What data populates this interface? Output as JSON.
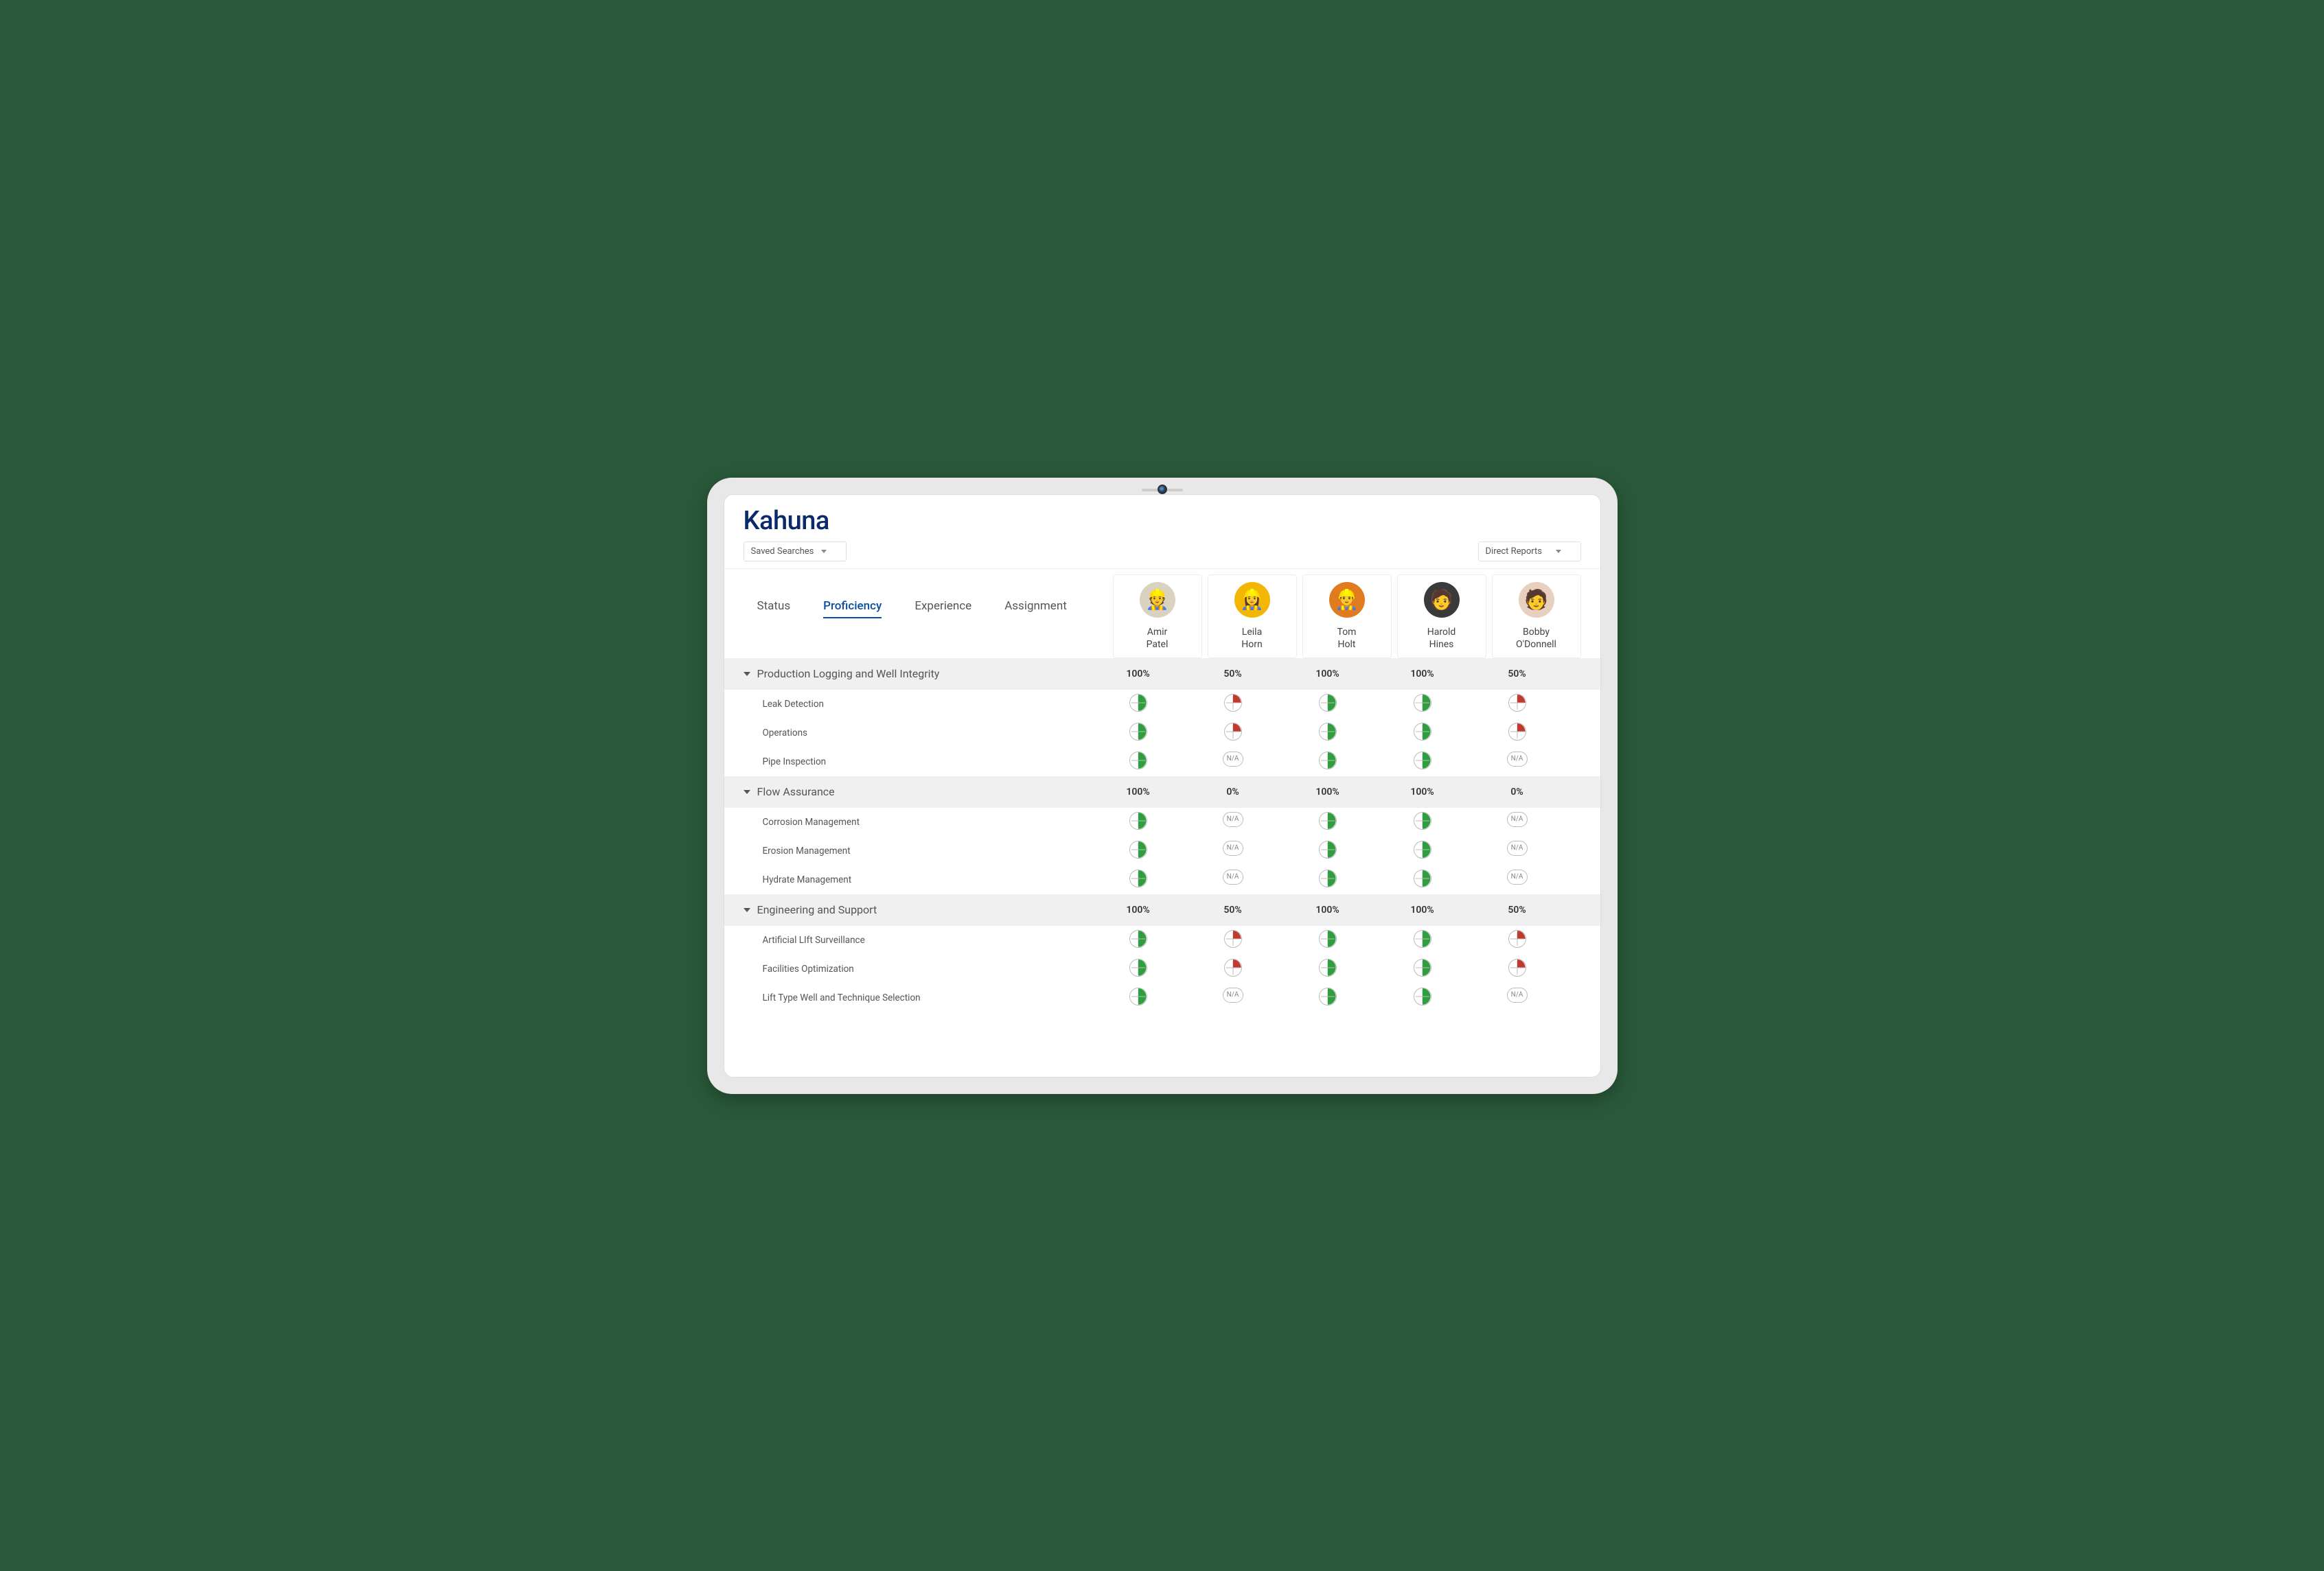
{
  "brand": "Kahuna",
  "toolbar": {
    "saved_searches_label": "Saved Searches",
    "direct_reports_label": "Direct Reports"
  },
  "tabs": [
    {
      "id": "status",
      "label": "Status",
      "active": false
    },
    {
      "id": "proficiency",
      "label": "Proficiency",
      "active": true
    },
    {
      "id": "experience",
      "label": "Experience",
      "active": false
    },
    {
      "id": "assignment",
      "label": "Assignment",
      "active": false
    }
  ],
  "people": [
    {
      "id": "amir",
      "first": "Amir",
      "last": "Patel",
      "avatar_bg": "#d9d2c0",
      "emoji": "👷"
    },
    {
      "id": "leila",
      "first": "Leila",
      "last": "Horn",
      "avatar_bg": "#f2b705",
      "emoji": "👷‍♀️"
    },
    {
      "id": "tom",
      "first": "Tom",
      "last": "Holt",
      "avatar_bg": "#e07b1f",
      "emoji": "👷‍♂️"
    },
    {
      "id": "harold",
      "first": "Harold",
      "last": "Hines",
      "avatar_bg": "#3a3a3a",
      "emoji": "🧑"
    },
    {
      "id": "bobby",
      "first": "Bobby",
      "last": "O'Donnell",
      "avatar_bg": "#e8d0c0",
      "emoji": "🧑"
    }
  ],
  "groups": [
    {
      "name": "Production Logging and Well Integrity",
      "scores": [
        "100%",
        "50%",
        "100%",
        "100%",
        "50%"
      ],
      "skills": [
        {
          "name": "Leak Detection",
          "cells": [
            "half-green",
            "q-red",
            "half-green",
            "half-green",
            "q-red"
          ]
        },
        {
          "name": "Operations",
          "cells": [
            "half-green",
            "q-red",
            "half-green",
            "half-green",
            "q-red"
          ]
        },
        {
          "name": "Pipe Inspection",
          "cells": [
            "half-green",
            "na",
            "half-green",
            "half-green",
            "na"
          ]
        }
      ]
    },
    {
      "name": "Flow Assurance",
      "scores": [
        "100%",
        "0%",
        "100%",
        "100%",
        "0%"
      ],
      "skills": [
        {
          "name": "Corrosion Management",
          "cells": [
            "half-green",
            "na",
            "half-green",
            "half-green",
            "na"
          ]
        },
        {
          "name": "Erosion Management",
          "cells": [
            "half-green",
            "na",
            "half-green",
            "half-green",
            "na"
          ]
        },
        {
          "name": "Hydrate Management",
          "cells": [
            "half-green",
            "na",
            "half-green",
            "half-green",
            "na"
          ]
        }
      ]
    },
    {
      "name": "Engineering and Support",
      "scores": [
        "100%",
        "50%",
        "100%",
        "100%",
        "50%"
      ],
      "skills": [
        {
          "name": "Artificial LIft Surveillance",
          "cells": [
            "half-green",
            "q-red",
            "half-green",
            "half-green",
            "q-red"
          ]
        },
        {
          "name": "Facilities Optimization",
          "cells": [
            "half-green",
            "q-red",
            "half-green",
            "half-green",
            "q-red"
          ]
        },
        {
          "name": "Lift Type Well and Technique Selection",
          "cells": [
            "half-green",
            "na",
            "half-green",
            "half-green",
            "na"
          ]
        }
      ]
    }
  ],
  "na_label": "N/A"
}
